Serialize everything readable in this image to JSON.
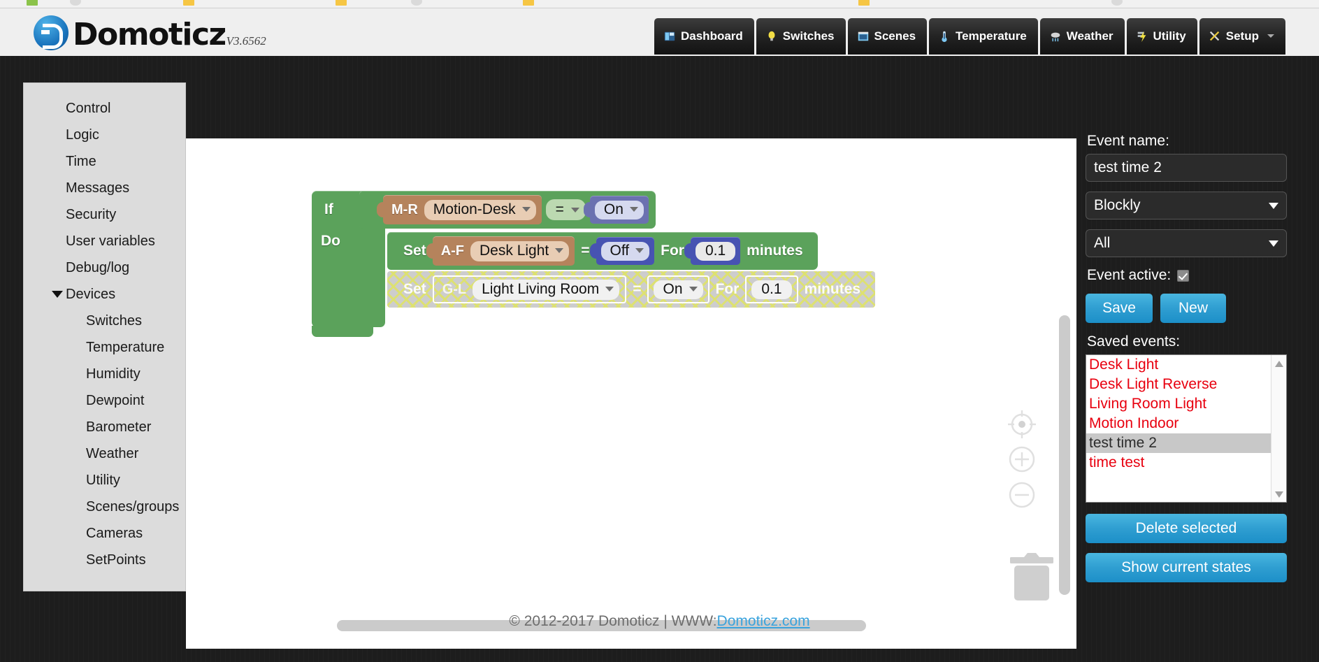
{
  "header": {
    "logo_text": "Domoticz",
    "version": "V3.6562",
    "nav": [
      {
        "label": "Dashboard",
        "icon": "dashboard-icon"
      },
      {
        "label": "Switches",
        "icon": "lightbulb-icon"
      },
      {
        "label": "Scenes",
        "icon": "scenes-icon"
      },
      {
        "label": "Temperature",
        "icon": "thermometer-icon"
      },
      {
        "label": "Weather",
        "icon": "rain-cloud-icon"
      },
      {
        "label": "Utility",
        "icon": "lightning-icon"
      },
      {
        "label": "Setup",
        "icon": "tools-icon",
        "has_caret": true
      }
    ]
  },
  "sidebar": {
    "items": [
      {
        "label": "Control",
        "sub": false,
        "expander": false
      },
      {
        "label": "Logic",
        "sub": false,
        "expander": false
      },
      {
        "label": "Time",
        "sub": false,
        "expander": false
      },
      {
        "label": "Messages",
        "sub": false,
        "expander": false
      },
      {
        "label": "Security",
        "sub": false,
        "expander": false
      },
      {
        "label": "User variables",
        "sub": false,
        "expander": false
      },
      {
        "label": "Debug/log",
        "sub": false,
        "expander": false
      },
      {
        "label": "Devices",
        "sub": false,
        "expander": true
      },
      {
        "label": "Switches",
        "sub": true,
        "expander": false
      },
      {
        "label": "Temperature",
        "sub": true,
        "expander": false
      },
      {
        "label": "Humidity",
        "sub": true,
        "expander": false
      },
      {
        "label": "Dewpoint",
        "sub": true,
        "expander": false
      },
      {
        "label": "Barometer",
        "sub": true,
        "expander": false
      },
      {
        "label": "Weather",
        "sub": true,
        "expander": false
      },
      {
        "label": "Utility",
        "sub": true,
        "expander": false
      },
      {
        "label": "Scenes/groups",
        "sub": true,
        "expander": false
      },
      {
        "label": "Cameras",
        "sub": true,
        "expander": false
      },
      {
        "label": "SetPoints",
        "sub": true,
        "expander": false
      }
    ]
  },
  "workspace": {
    "if_label": "If",
    "do_label": "Do",
    "if_row": {
      "device_prefix": "M-R",
      "device_name": "Motion-Desk",
      "operator": "=",
      "state": "On"
    },
    "do_row": {
      "set_label": "Set",
      "device_prefix": "A-F",
      "device_name": "Desk Light",
      "operator": "=",
      "state": "Off",
      "for_label": "For",
      "duration": "0.1",
      "unit_label": "minutes"
    },
    "ghost_row": {
      "set_label": "Set",
      "device_prefix": "G-L",
      "device_name": "Light Living Room",
      "operator": "=",
      "state": "On",
      "for_label": "For",
      "duration": "0.1",
      "unit_label": "minutes"
    },
    "controls": [
      {
        "name": "center-target-icon"
      },
      {
        "name": "zoom-in-icon"
      },
      {
        "name": "zoom-out-icon"
      },
      {
        "name": "trash-icon"
      }
    ],
    "colors": {
      "block_green": "#5ba25b",
      "device_brown": "#b5835c",
      "state_purple": "#6b71b0",
      "state_blue": "#4753b2",
      "compare_green": "#bcd9b1"
    }
  },
  "right_panel": {
    "event_name_label": "Event name:",
    "event_name_value": "test time 2",
    "editor_type": "Blockly",
    "filter": "All",
    "event_active_label": "Event active:",
    "event_active_checked": true,
    "save_label": "Save",
    "new_label": "New",
    "saved_events_label": "Saved events:",
    "saved_events": [
      {
        "name": "Desk Light",
        "selected": false
      },
      {
        "name": "Desk Light Reverse",
        "selected": false
      },
      {
        "name": "Living Room Light",
        "selected": false
      },
      {
        "name": "Motion Indoor",
        "selected": false
      },
      {
        "name": "test time 2",
        "selected": true
      },
      {
        "name": "time test",
        "selected": false
      }
    ],
    "delete_label": "Delete selected",
    "show_states_label": "Show current states",
    "colors": {
      "button_blue": "#2f9ed1",
      "event_red": "#e8000f",
      "selected_grey": "#c8c8c8"
    }
  },
  "footer": {
    "copyright": "© 2012-2017 Domoticz | WWW: ",
    "link": "Domoticz.com"
  }
}
